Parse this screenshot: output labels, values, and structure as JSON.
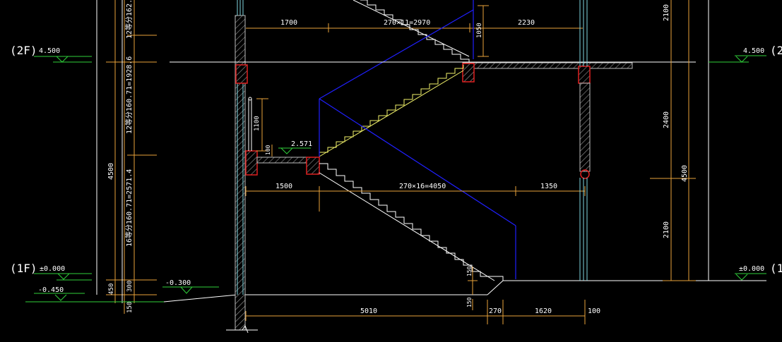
{
  "colors": {
    "background": "#000000",
    "wall": "#7a7a7a",
    "grid_cyan": "#7fd6e0",
    "dim_orange": "#e8a23a",
    "level_green": "#2fcf3a",
    "stair_white": "#ffffff",
    "stair_yellow": "#f2f26a",
    "outline_blue": "#2020ff",
    "beam_red": "#e02020"
  },
  "levels": {
    "f2_tag": "(2F)",
    "f2_value": "4.500",
    "f2_value_right": "4.500",
    "f2_tag_right": "(2",
    "f1_tag": "(1F)",
    "f1_value": "±0.000",
    "f1_value_right": "±0.000",
    "f1_tag_right": "(1",
    "outdoor_value": "-0.450",
    "step_value": "-0.300",
    "landing_value": "2.571"
  },
  "dimensions": {
    "top_left": "1700",
    "top_mid": "270×11=2970",
    "top_right": "2230",
    "top_rise": "1050",
    "mid_left": "1500",
    "mid_mid": "270×16=4050",
    "mid_right": "1350",
    "bottom_mid": "5010",
    "bottom_tread": "270",
    "bottom_right": "1620",
    "bottom_edge": "100",
    "railing_height": "1100",
    "landing_step": "100",
    "lower_riser": "150",
    "lower_riser2": "150",
    "left_total": "4500",
    "left_flight_upper_partial": "12等分162.5=19",
    "left_flight_mid": "12等分160.71=1928.6",
    "left_flight_low": "16等分160.71=2571.4",
    "left_450": "450",
    "left_300": "300",
    "left_150": "150",
    "right_total": "4500",
    "right_top": "2100",
    "right_mid": "2400",
    "right_bottom": "2100"
  }
}
